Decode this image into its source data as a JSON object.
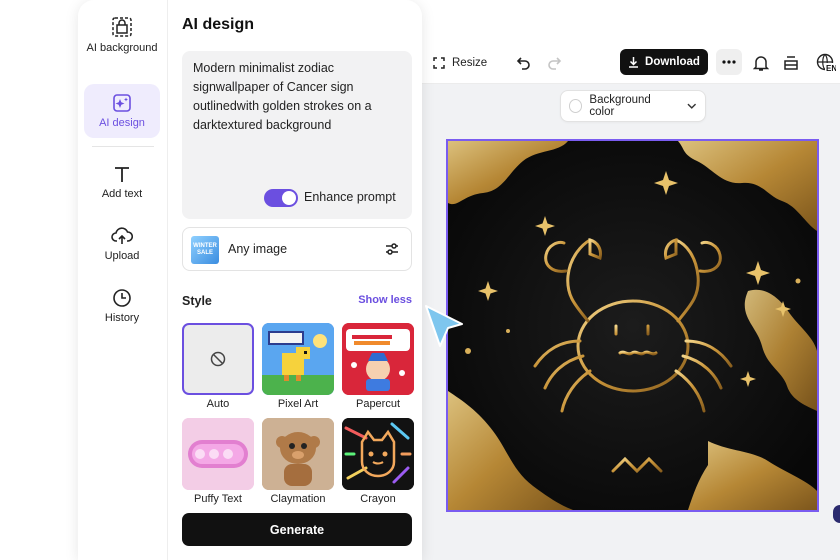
{
  "sidebar": {
    "items": [
      {
        "label": "AI background",
        "icon": "ai-background-icon"
      },
      {
        "label": "AI design",
        "icon": "ai-design-icon",
        "active": true
      },
      {
        "label": "Add text",
        "icon": "text-icon"
      },
      {
        "label": "Upload",
        "icon": "upload-icon"
      },
      {
        "label": "History",
        "icon": "history-icon"
      }
    ]
  },
  "panel": {
    "title": "AI design",
    "prompt": "Modern minimalist zodiac signwallpaper of Cancer sign outlinedwith golden strokes on a darktextured background",
    "enhance_label": "Enhance prompt",
    "enhance_on": true,
    "reference_label": "Any image",
    "reference_thumb_text": "WINTER SALE",
    "style_label": "Style",
    "show_less": "Show less",
    "styles": [
      {
        "label": "Auto",
        "selected": true
      },
      {
        "label": "Pixel Art"
      },
      {
        "label": "Papercut"
      },
      {
        "label": "Puffy Text"
      },
      {
        "label": "Claymation"
      },
      {
        "label": "Crayon"
      }
    ],
    "generate_label": "Generate"
  },
  "toolbar": {
    "resize_label": "Resize",
    "download_label": "Download",
    "lang_label": "EN"
  },
  "canvas": {
    "background_color_label": "Background color"
  },
  "colors": {
    "accent": "#6b4fe0",
    "gold": "#d4a94a",
    "dark": "#111111"
  }
}
